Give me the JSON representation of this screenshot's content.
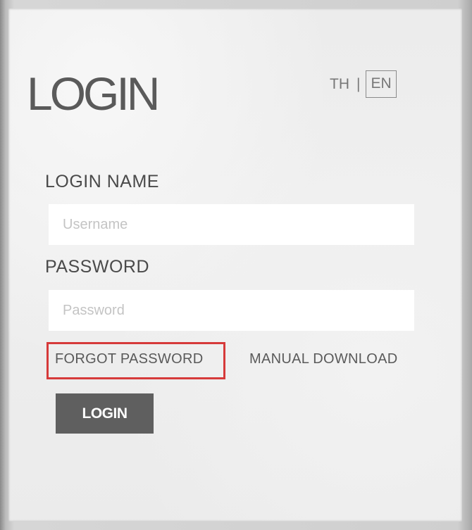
{
  "login": {
    "title": "LOGIN",
    "language": {
      "th_label": "TH",
      "separator": "|",
      "en_label": "EN",
      "selected": "EN"
    },
    "username": {
      "label": "LOGIN NAME",
      "placeholder": "Username",
      "value": ""
    },
    "password": {
      "label": "PASSWORD",
      "placeholder": "Password",
      "value": ""
    },
    "links": {
      "forgot_password": "FORGOT PASSWORD",
      "manual_download": "MANUAL DOWNLOAD"
    },
    "highlight_color": "#d63a3a",
    "submit_label": "LOGIN"
  }
}
